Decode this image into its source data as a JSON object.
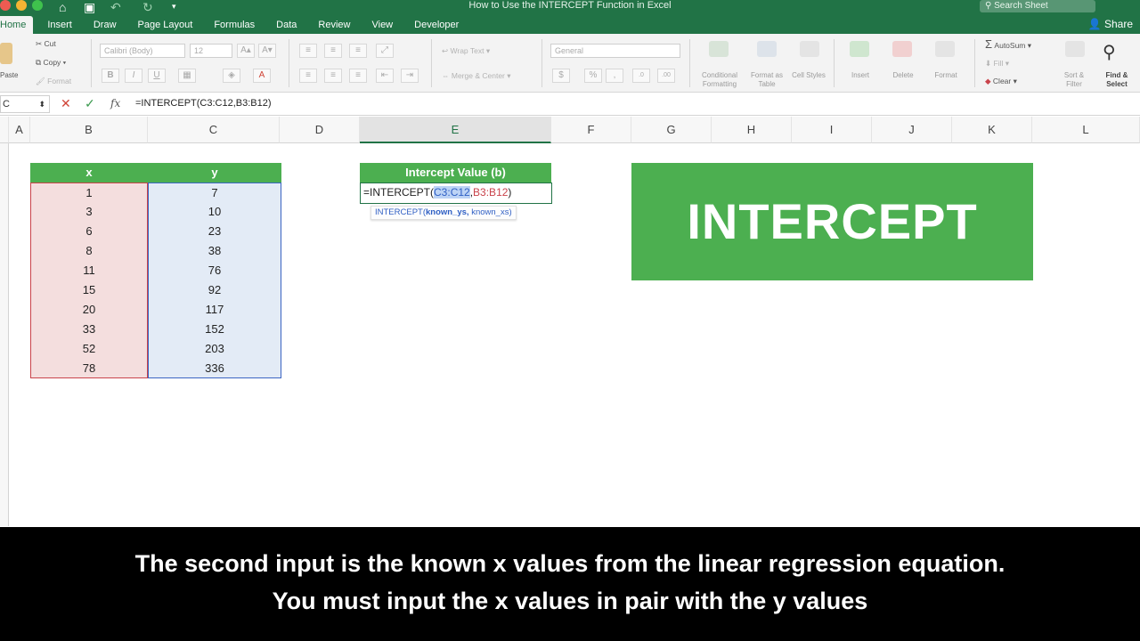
{
  "window": {
    "title": "How to Use the INTERCEPT Function in Excel",
    "search_placeholder": "Search Sheet",
    "share_label": "Share",
    "traffic_light_colors": [
      "#ee5b52",
      "#f5b433",
      "#3fc24d"
    ]
  },
  "tabs": [
    {
      "label": "Home",
      "active": true
    },
    {
      "label": "Insert",
      "active": false
    },
    {
      "label": "Draw",
      "active": false
    },
    {
      "label": "Page Layout",
      "active": false
    },
    {
      "label": "Formulas",
      "active": false
    },
    {
      "label": "Data",
      "active": false
    },
    {
      "label": "Review",
      "active": false
    },
    {
      "label": "View",
      "active": false
    },
    {
      "label": "Developer",
      "active": false
    }
  ],
  "ribbon": {
    "paste_label": "Paste",
    "cut_label": "Cut",
    "copy_label": "Copy",
    "format_label": "Format",
    "font_name": "Calibri (Body)",
    "font_size": "12",
    "wrap_text_label": "Wrap Text",
    "merge_center_label": "Merge & Center",
    "number_format": "General",
    "conditional_formatting_label": "Conditional Formatting",
    "format_as_table_label": "Format as Table",
    "cell_styles_label": "Cell Styles",
    "insert_label": "Insert",
    "delete_label": "Delete",
    "format_cells_label": "Format",
    "autosum_label": "AutoSum",
    "fill_label": "Fill",
    "clear_label": "Clear",
    "sort_filter_label": "Sort & Filter",
    "find_select_label": "Find & Select"
  },
  "formula_bar": {
    "name_box": "C",
    "formula": "=INTERCEPT(C3:C12,B3:B12)"
  },
  "columns": [
    "A",
    "B",
    "C",
    "D",
    "E",
    "F",
    "G",
    "H",
    "I",
    "J",
    "K",
    "L"
  ],
  "selected_column": "E",
  "table": {
    "x_header": "x",
    "y_header": "y",
    "x_values": [
      "1",
      "3",
      "6",
      "8",
      "11",
      "15",
      "20",
      "33",
      "52",
      "78"
    ],
    "y_values": [
      "7",
      "10",
      "23",
      "38",
      "76",
      "92",
      "117",
      "152",
      "203",
      "336"
    ]
  },
  "intercept_cell": {
    "header": "Intercept Value (b)",
    "formula_prefix": "=INTERCEPT(",
    "ref_y": "C3:C12",
    "separator": ",",
    "ref_x": "B3:B12",
    "formula_suffix": ")",
    "tooltip_fn": "INTERCEPT(",
    "tooltip_arg1": "known_ys,",
    "tooltip_arg2": " known_xs)"
  },
  "banner": {
    "text": "INTERCEPT"
  },
  "subtitle": {
    "line1": "The second input is the known x values from the linear regression equation.",
    "line2": "You must input the x values in pair with the y values"
  },
  "colors": {
    "excel_green": "#217346",
    "header_green": "#4caf50",
    "x_range_red": "#c9434b",
    "y_range_blue": "#3b65c2"
  }
}
